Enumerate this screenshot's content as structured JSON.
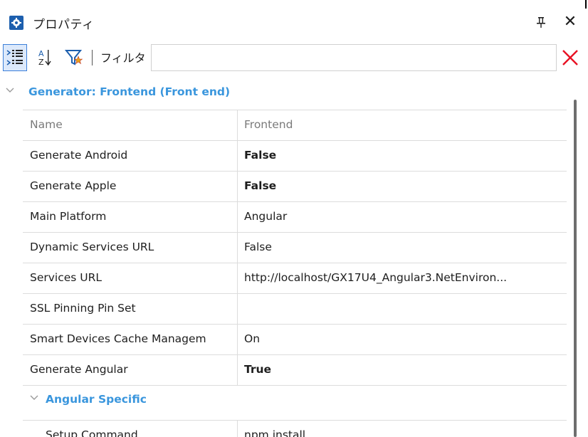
{
  "window": {
    "title": "プロパティ",
    "pin_glyph": "ꟸ",
    "close_glyph": "✕"
  },
  "toolbar": {
    "categorized_icon": "categorized-view-icon",
    "sort_icon": "sort-az-icon",
    "filter_icon": "filter-star-icon",
    "filter_label": "フィルタ",
    "filter_value": "",
    "clear_icon": "clear-x-icon"
  },
  "categories": [
    {
      "label": "Generator: Frontend (Front end)"
    },
    {
      "label": "Angular Specific"
    }
  ],
  "properties": [
    {
      "name": "Name",
      "value": "Frontend"
    },
    {
      "name": "Generate Android",
      "value": "False"
    },
    {
      "name": "Generate Apple",
      "value": "False"
    },
    {
      "name": "Main Platform",
      "value": "Angular"
    },
    {
      "name": "Dynamic Services URL",
      "value": "False"
    },
    {
      "name": "Services URL",
      "value": "http://localhost/GX17U4_Angular3.NetEnviron..."
    },
    {
      "name": "SSL Pinning Pin Set",
      "value": ""
    },
    {
      "name": "Smart Devices Cache Managem",
      "value": "On"
    },
    {
      "name": "Generate Angular",
      "value": "True"
    }
  ],
  "angular_properties": [
    {
      "name": "Setup Command",
      "value": "npm install"
    }
  ],
  "colors": {
    "accent": "#3a96dd",
    "clear": "#e81123",
    "icon_blue": "#1d5fae"
  }
}
